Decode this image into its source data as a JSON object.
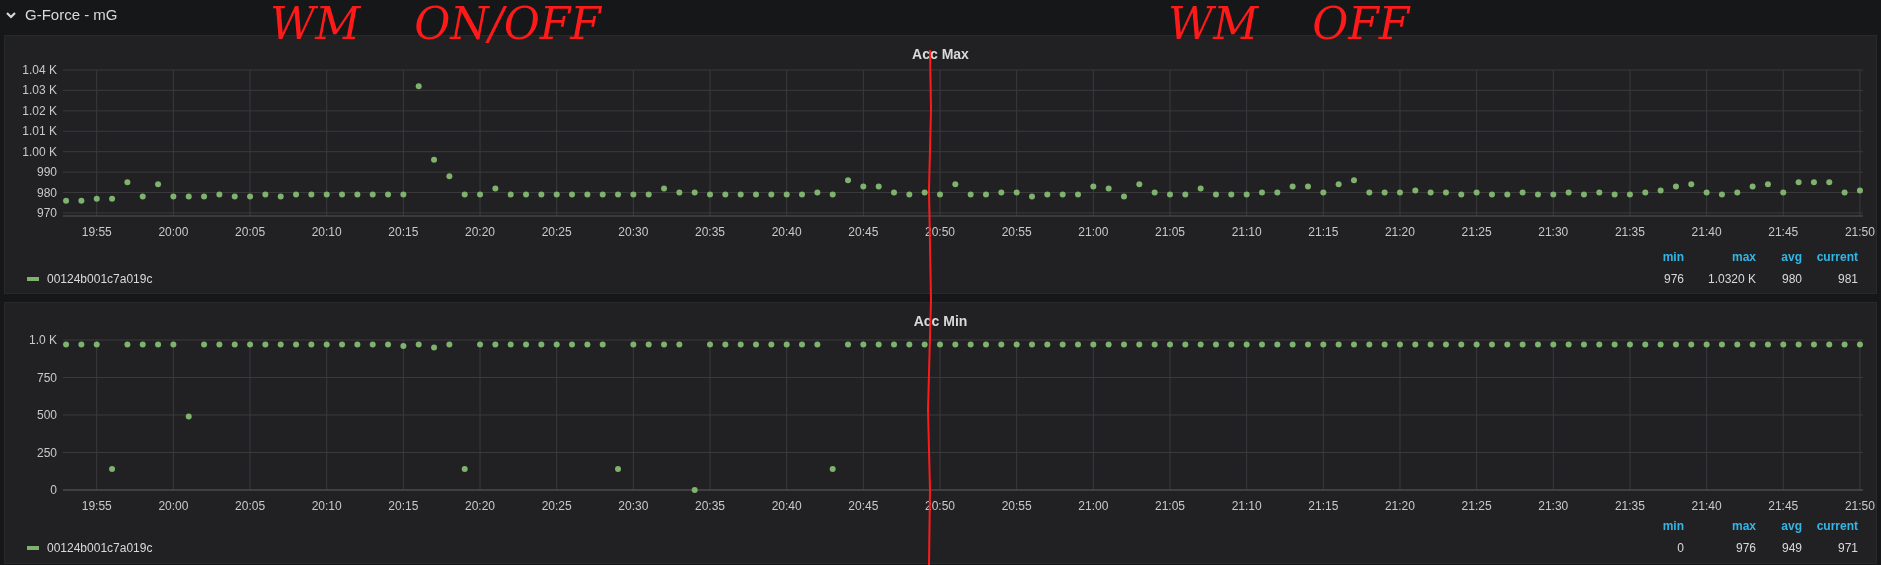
{
  "row": {
    "title": "G-Force - mG",
    "expanded": true
  },
  "annotations": [
    {
      "text": "WM ON/OFF"
    },
    {
      "text": "WM OFF"
    }
  ],
  "panels": [
    {
      "chart_data": {
        "type": "scatter",
        "title": "Acc Max",
        "grid": true,
        "ylim": [
          968.5,
          1040
        ],
        "categories": [
          null,
          null,
          "19:55",
          null,
          null,
          null,
          null,
          "20:00",
          null,
          null,
          null,
          null,
          "20:05",
          null,
          null,
          null,
          null,
          "20:10",
          null,
          null,
          null,
          null,
          "20:15",
          null,
          null,
          null,
          null,
          "20:20",
          null,
          null,
          null,
          null,
          "20:25",
          null,
          null,
          null,
          null,
          "20:30",
          null,
          null,
          null,
          null,
          "20:35",
          null,
          null,
          null,
          null,
          "20:40",
          null,
          null,
          null,
          null,
          "20:45",
          null,
          null,
          null,
          null,
          "20:50",
          null,
          null,
          null,
          null,
          "20:55",
          null,
          null,
          null,
          null,
          "21:00",
          null,
          null,
          null,
          null,
          "21:05",
          null,
          null,
          null,
          null,
          "21:10",
          null,
          null,
          null,
          null,
          "21:15",
          null,
          null,
          null,
          null,
          "21:20",
          null,
          null,
          null,
          null,
          "21:25",
          null,
          null,
          null,
          null,
          "21:30",
          null,
          null,
          null,
          null,
          "21:35",
          null,
          null,
          null,
          null,
          "21:40",
          null,
          null,
          null,
          null,
          "21:45",
          null,
          null,
          null,
          null,
          "21:50"
        ],
        "yticks": [
          {
            "value": 970,
            "label": "970"
          },
          {
            "value": 980,
            "label": "980"
          },
          {
            "value": 990,
            "label": "990"
          },
          {
            "value": 1000,
            "label": "1.00 K"
          },
          {
            "value": 1010,
            "label": "1.01 K"
          },
          {
            "value": 1020,
            "label": "1.02 K"
          },
          {
            "value": 1030,
            "label": "1.03 K"
          },
          {
            "value": 1040,
            "label": "1.04 K"
          }
        ],
        "series": [
          {
            "name": "00124b001c7a019c",
            "color": "#7eb26d",
            "values": [
              976,
              976,
              977,
              977,
              985,
              978,
              984,
              978,
              978,
              978,
              979,
              978,
              978,
              979,
              978,
              979,
              979,
              979,
              979,
              979,
              979,
              979,
              979,
              1032,
              996,
              988,
              979,
              979,
              982,
              979,
              979,
              979,
              979,
              979,
              979,
              979,
              979,
              979,
              979,
              982,
              980,
              980,
              979,
              979,
              979,
              979,
              979,
              979,
              979,
              980,
              979,
              986,
              983,
              983,
              980,
              979,
              980,
              979,
              984,
              979,
              979,
              980,
              980,
              978,
              979,
              979,
              979,
              983,
              982,
              978,
              984,
              980,
              979,
              979,
              982,
              979,
              979,
              979,
              980,
              980,
              983,
              983,
              980,
              984,
              986,
              980,
              980,
              980,
              981,
              980,
              980,
              979,
              980,
              979,
              979,
              980,
              979,
              979,
              980,
              979,
              980,
              979,
              979,
              980,
              981,
              983,
              984,
              980,
              979,
              980,
              983,
              984,
              980,
              985,
              985,
              985,
              980,
              981
            ]
          }
        ]
      },
      "legend": {
        "stats": [
          {
            "label": "min",
            "value": "976"
          },
          {
            "label": "max",
            "value": "1.0320 K"
          },
          {
            "label": "avg",
            "value": "980"
          },
          {
            "label": "current",
            "value": "981"
          }
        ]
      }
    },
    {
      "chart_data": {
        "type": "scatter",
        "title": "Acc Min",
        "grid": true,
        "ylim": [
          0,
          1000
        ],
        "categories": [
          null,
          null,
          "19:55",
          null,
          null,
          null,
          null,
          "20:00",
          null,
          null,
          null,
          null,
          "20:05",
          null,
          null,
          null,
          null,
          "20:10",
          null,
          null,
          null,
          null,
          "20:15",
          null,
          null,
          null,
          null,
          "20:20",
          null,
          null,
          null,
          null,
          "20:25",
          null,
          null,
          null,
          null,
          "20:30",
          null,
          null,
          null,
          null,
          "20:35",
          null,
          null,
          null,
          null,
          "20:40",
          null,
          null,
          null,
          null,
          "20:45",
          null,
          null,
          null,
          null,
          "20:50",
          null,
          null,
          null,
          null,
          "20:55",
          null,
          null,
          null,
          null,
          "21:00",
          null,
          null,
          null,
          null,
          "21:05",
          null,
          null,
          null,
          null,
          "21:10",
          null,
          null,
          null,
          null,
          "21:15",
          null,
          null,
          null,
          null,
          "21:20",
          null,
          null,
          null,
          null,
          "21:25",
          null,
          null,
          null,
          null,
          "21:30",
          null,
          null,
          null,
          null,
          "21:35",
          null,
          null,
          null,
          null,
          "21:40",
          null,
          null,
          null,
          null,
          "21:45",
          null,
          null,
          null,
          null,
          "21:50"
        ],
        "yticks": [
          {
            "value": 0,
            "label": "0"
          },
          {
            "value": 250,
            "label": "250"
          },
          {
            "value": 500,
            "label": "500"
          },
          {
            "value": 750,
            "label": "750"
          },
          {
            "value": 1000,
            "label": "1.0 K"
          }
        ],
        "series": [
          {
            "name": "00124b001c7a019c",
            "color": "#7eb26d",
            "values": [
              970,
              970,
              970,
              140,
              970,
              970,
              970,
              970,
              490,
              970,
              970,
              970,
              970,
              970,
              970,
              970,
              970,
              970,
              970,
              970,
              970,
              970,
              960,
              970,
              950,
              970,
              140,
              970,
              970,
              970,
              970,
              970,
              970,
              970,
              970,
              970,
              140,
              970,
              970,
              970,
              970,
              0,
              970,
              970,
              970,
              970,
              970,
              970,
              970,
              970,
              140,
              970,
              970,
              970,
              970,
              970,
              970,
              970,
              970,
              970,
              970,
              970,
              970,
              970,
              970,
              970,
              970,
              970,
              970,
              970,
              970,
              970,
              970,
              970,
              970,
              970,
              970,
              970,
              970,
              970,
              970,
              970,
              970,
              970,
              970,
              970,
              970,
              970,
              970,
              970,
              970,
              970,
              970,
              970,
              970,
              970,
              970,
              970,
              970,
              970,
              970,
              970,
              970,
              970,
              970,
              970,
              970,
              970,
              970,
              970,
              970,
              970,
              970,
              970,
              970,
              970,
              970,
              970
            ]
          }
        ]
      },
      "legend": {
        "stats": [
          {
            "label": "min",
            "value": "0"
          },
          {
            "label": "max",
            "value": "976"
          },
          {
            "label": "avg",
            "value": "949"
          },
          {
            "label": "current",
            "value": "971"
          }
        ]
      }
    }
  ]
}
